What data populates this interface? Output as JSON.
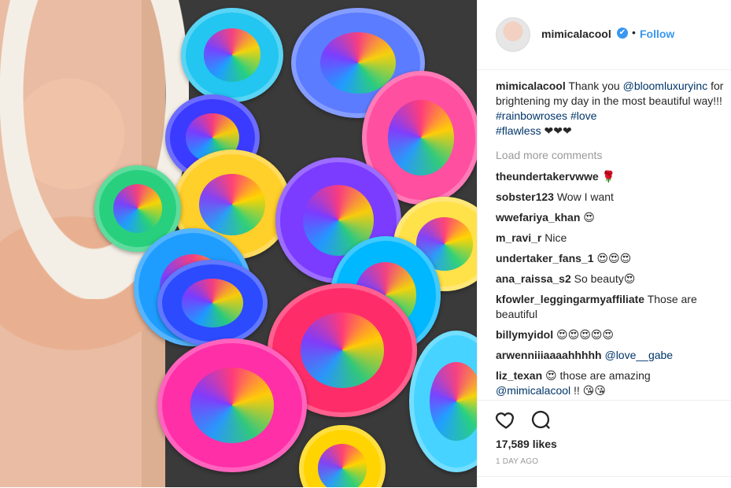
{
  "header": {
    "username": "mimicalacool",
    "verified": "✔",
    "bullet": "•",
    "follow_label": "Follow"
  },
  "caption": {
    "username": "mimicalacool",
    "text_1": " Thank you ",
    "mention": "@bloomluxuryinc",
    "text_2": " for brightening my day in the most beautiful way!!! ",
    "tag_1": "#rainbowroses",
    "tag_2": "#love",
    "tag_3": "#flawless",
    "emoji": " ❤❤❤"
  },
  "load_more_label": "Load more comments",
  "comments": [
    {
      "username": "theundertakervwwe",
      "text": " 🌹"
    },
    {
      "username": "sobster123",
      "text": " Wow I want"
    },
    {
      "username": "wwefariya_khan",
      "text": " 😍"
    },
    {
      "username": "m_ravi_r",
      "text": " Nice"
    },
    {
      "username": "undertaker_fans_1",
      "text": " 😍😍😍"
    },
    {
      "username": "ana_raissa_s2",
      "text": " So beauty😍"
    },
    {
      "username": "kfowler_leggingarmyaffiliate",
      "text": " Those are beautiful"
    },
    {
      "username": "billymyidol",
      "text": " 😍😍😍😍😍"
    },
    {
      "username": "arwenniiiaaaahhhhh",
      "mention": "@love__gabe"
    },
    {
      "username": "liz_texan",
      "text": " 😍 those are amazing ",
      "mention": "@mimicalacool",
      "suffix": " !! 😘😘"
    }
  ],
  "icons": {
    "like": "heart-icon",
    "comment": "comment-icon",
    "verified": "verified-badge-icon"
  },
  "likes_label": "17,589 likes",
  "time_label": "1 DAY AGO",
  "colors": {
    "link": "#003569",
    "follow": "#3897f0",
    "muted": "#999999",
    "border": "#efefef"
  }
}
